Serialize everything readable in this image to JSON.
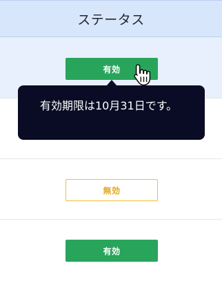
{
  "table": {
    "header": {
      "label": "ステータス"
    },
    "rows": [
      {
        "status_label": "有効",
        "status": "valid"
      },
      {
        "status_label": "",
        "status": "valid"
      },
      {
        "status_label": "無効",
        "status": "invalid"
      },
      {
        "status_label": "有効",
        "status": "valid"
      }
    ]
  },
  "tooltip": {
    "text": "有効期限は10月31日です。"
  },
  "colors": {
    "header_bg": "#d8e6fb",
    "highlight_row_bg": "#e8f0fd",
    "valid_badge": "#28a55b",
    "invalid_badge_border": "#f0c03a",
    "tooltip_bg": "#0a0b24"
  },
  "cursor": {
    "icon": "hand-pointer-icon"
  }
}
